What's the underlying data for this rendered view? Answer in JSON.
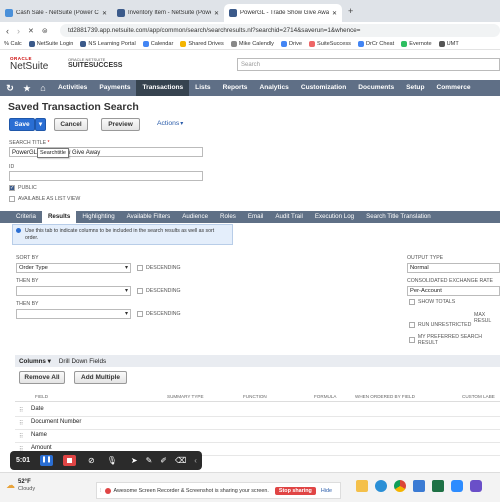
{
  "browser": {
    "tabs": [
      {
        "label": "Cash Sale - NetSuite (Power Cloud I...",
        "color": "#4a90d9"
      },
      {
        "label": "Inventory Item - NetSuite (Power Cl...",
        "color": "#3b5a8a"
      },
      {
        "label": "PowerGL - Trade Show Give Awa...",
        "color": "#3b5a8a"
      }
    ],
    "url": "td2881739.app.netsuite.com/app/common/search/searchresults.nl?searchid=2714&saverun=1&whence=",
    "bookmarks": [
      "% Calc",
      "NetSuite Login",
      "NS Learning Portal",
      "Calendar",
      "Shared Drives",
      "Mike Calendly",
      "Drive",
      "SuiteSuccess",
      "DrCr Cheat",
      "Evernote",
      "UMT"
    ]
  },
  "netsuite": {
    "logo_top": "ORACLE",
    "logo_main": "NetSuite",
    "suite_top": "ORACLE NETSUITE",
    "suite_main": "SUITESUCCESS",
    "search_placeholder": "Search",
    "nav": [
      "Activities",
      "Payments",
      "Transactions",
      "Lists",
      "Reports",
      "Analytics",
      "Customization",
      "Documents",
      "Setup",
      "Commerce"
    ],
    "nav_selected": "Transactions"
  },
  "page": {
    "title": "Saved Transaction Search",
    "save_label": "Save",
    "cancel_label": "Cancel",
    "preview_label": "Preview",
    "actions_label": "Actions",
    "search_title_label": "SEARCH TITLE",
    "search_title_value": "PowerGL",
    "search_title_value_rest": "w Give Away",
    "tooltip": "Searchtitle",
    "id_label": "ID",
    "public_label": "PUBLIC",
    "available_label": "AVAILABLE AS LIST VIEW"
  },
  "subtabs": [
    "Criteria",
    "Results",
    "Highlighting",
    "Available Filters",
    "Audience",
    "Roles",
    "Email",
    "Audit Trail",
    "Execution Log",
    "Search Title Translation"
  ],
  "subtab_selected": "Results",
  "info_text": "Use this tab to indicate columns to be included in the search results as well as sort order.",
  "sort": {
    "sort_by_label": "SORT BY",
    "sort_by_value": "Order Type",
    "then_by_label": "THEN BY",
    "descending_label": "DESCENDING"
  },
  "output": {
    "output_type_label": "OUTPUT TYPE",
    "output_type_value": "Normal",
    "exchange_label": "CONSOLIDATED EXCHANGE RATE",
    "exchange_value": "Per-Account",
    "show_totals_label": "SHOW TOTALS",
    "max_results_label": "MAX RESUL",
    "run_unrestricted_label": "RUN UNRESTRICTED",
    "preferred_label": "MY PREFERRED SEARCH RESULT"
  },
  "columns": {
    "tab_label": "Columns",
    "drill_label": "Drill Down Fields",
    "remove_all": "Remove All",
    "add_multiple": "Add Multiple",
    "headers": [
      "FIELD",
      "SUMMARY TYPE",
      "FUNCTION",
      "FORMULA",
      "WHEN ORDERED BY FIELD",
      "CUSTOM LABE"
    ],
    "rows": [
      "Date",
      "Document Number",
      "Name",
      "Amount"
    ]
  },
  "recorder": {
    "time": "5:01"
  },
  "taskbar": {
    "temp": "52°F",
    "weather": "Cloudy",
    "share_text": "Awesome Screen Recorder & Screenshot is sharing your screen.",
    "stop_label": "Stop sharing",
    "hide_label": "Hide"
  },
  "colors": {
    "nav_bg": "#5f6f86",
    "nav_selected": "#36434f",
    "save_blue": "#2a6ed3",
    "stop_red": "#e04545"
  }
}
